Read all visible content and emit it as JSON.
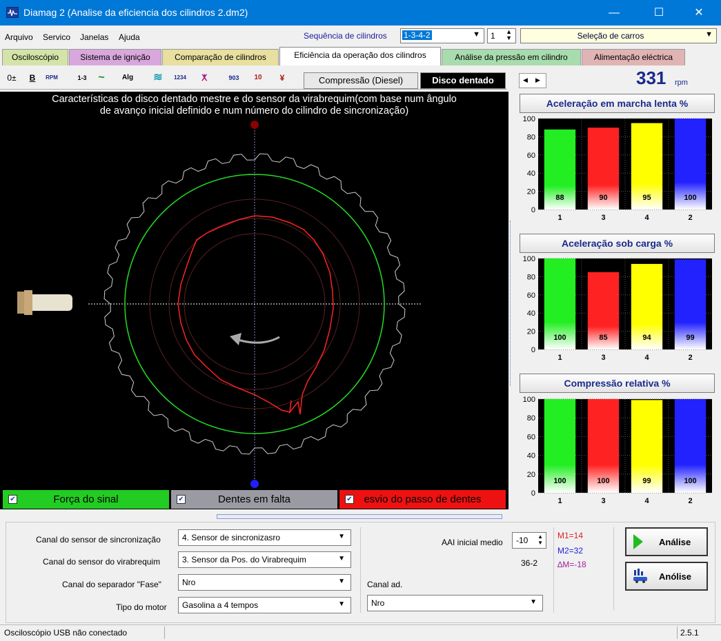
{
  "window": {
    "title": "Diamag 2 (Analise da eficiencia dos cilindros 2.dm2)",
    "minimize": "—",
    "maximize": "☐",
    "close": "✕"
  },
  "menu": {
    "items": [
      "Arquivo",
      "Servico",
      "Janelas",
      "Ajuda"
    ],
    "seq_label": "Sequência de cilindros",
    "seq_value": "1-3-4-2",
    "num_value": "1",
    "car_label": "Seleção de carros"
  },
  "tabs": [
    {
      "label": "Osciloscópio",
      "color": "#d4e4a8"
    },
    {
      "label": "Sistema de ignição",
      "color": "#d8a8dc"
    },
    {
      "label": "Comparação de cilindros",
      "color": "#e8dfa0"
    },
    {
      "label": "Eficiência da operação dos cilindros",
      "color": "#ffffff"
    },
    {
      "label": "Análise da pressão em cilindro",
      "color": "#a8dcae"
    },
    {
      "label": "Alimentação eléctrica",
      "color": "#e0b4b4"
    }
  ],
  "toolbar": {
    "icons": [
      "0±",
      "B",
      "RPM",
      "1-3",
      "~",
      "Alg",
      "≋",
      "1234",
      "ⵅ",
      "903",
      "10",
      "¥"
    ],
    "mode_compression": "Compressão (Diesel)",
    "mode_toothed": "Disco dentado",
    "nav_left": "◀",
    "nav_right": "▶"
  },
  "rpm": {
    "value": "331",
    "unit": "rpm"
  },
  "scope": {
    "title_line1": "Características do disco dentado mestre e do sensor da virabrequim(com base num ângulo",
    "title_line2": "de avanço inicial definido e num número do cilindro de sincronização)",
    "legend": [
      {
        "label": "Força do sinal",
        "bg": "#22cc22",
        "checked": "✔"
      },
      {
        "label": "Dentes em falta",
        "bg": "#9a9aa2",
        "checked": "✔"
      },
      {
        "label": "esvio do passo de dentes",
        "bg": "#ee1111",
        "checked": "✔"
      }
    ]
  },
  "chart_data": [
    {
      "type": "bar",
      "title": "Aceleração em marcha lenta %",
      "categories": [
        "1",
        "3",
        "4",
        "2"
      ],
      "values": [
        88,
        90,
        95,
        100
      ],
      "ylim": [
        0,
        100
      ],
      "yticks": [
        "0",
        "20",
        "40",
        "60",
        "80",
        "100"
      ],
      "colors": [
        "#22ee22",
        "#ff2222",
        "#ffff00",
        "#2222ff"
      ]
    },
    {
      "type": "bar",
      "title": "Aceleração sob carga %",
      "categories": [
        "1",
        "3",
        "4",
        "2"
      ],
      "values": [
        100,
        85,
        94,
        99
      ],
      "ylim": [
        0,
        100
      ],
      "yticks": [
        "0",
        "20",
        "40",
        "60",
        "80",
        "100"
      ],
      "colors": [
        "#22ee22",
        "#ff2222",
        "#ffff00",
        "#2222ff"
      ]
    },
    {
      "type": "bar",
      "title": "Compressão relativa %",
      "categories": [
        "1",
        "3",
        "4",
        "2"
      ],
      "values": [
        100,
        100,
        99,
        100
      ],
      "ylim": [
        0,
        100
      ],
      "yticks": [
        "0",
        "20",
        "40",
        "60",
        "80",
        "100"
      ],
      "colors": [
        "#22ee22",
        "#ff2222",
        "#ffff00",
        "#2222ff"
      ]
    }
  ],
  "settings": {
    "sync_label": "Canal do sensor de sincronização",
    "sync_value": "4.  Sensor de sincronizasro",
    "crank_label": "Canal do sensor do virabrequim",
    "crank_value": "3.  Sensor da Pos. do Virabrequim",
    "phase_label": "Canal do separador \"Fase\"",
    "phase_value": "Nro",
    "engine_label": "Tipo do motor",
    "engine_value": "Gasolina a 4 tempos",
    "aai_label": "AAI inicial medio",
    "aai_value": "-10",
    "teeth_value": "36-2",
    "canal_ad_label": "Canal ad.",
    "canal_ad_value": "Nro",
    "m1": "M1=14",
    "m2": "M2=32",
    "dm": "∆M=-18",
    "btn_analise": "Análise",
    "btn_anolise": "Anólise"
  },
  "status": {
    "text": "Osciloscópio USB não conectado",
    "version": "2.5.1"
  }
}
